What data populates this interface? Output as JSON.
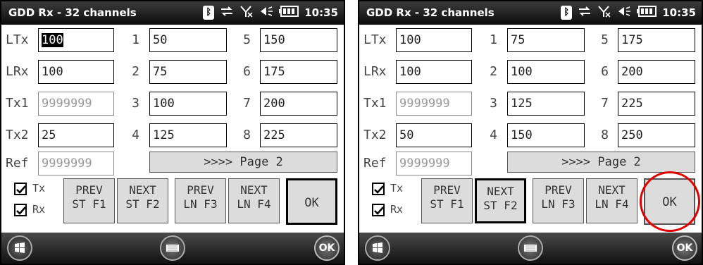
{
  "app_title": "GDD Rx - 32 channels",
  "status": {
    "time": "10:35",
    "icons": [
      "bluetooth-icon",
      "sync-icon",
      "no-signal-icon",
      "volume-icon",
      "battery-icon"
    ]
  },
  "labels": {
    "ltx": "LTx",
    "lrx": "LRx",
    "tx1": "Tx1",
    "tx2": "Tx2",
    "ref": "Ref",
    "ch1": "1",
    "ch2": "2",
    "ch3": "3",
    "ch4": "4",
    "ch5": "5",
    "ch6": "6",
    "ch7": "7",
    "ch8": "8",
    "tx_check": "Tx",
    "rx_check": "Rx"
  },
  "buttons": {
    "page2": ">>>> Page 2",
    "prev_st": [
      "PREV",
      "ST F1"
    ],
    "next_st": [
      "NEXT",
      "ST F2"
    ],
    "prev_ln": [
      "PREV",
      "LN F3"
    ],
    "next_ln": [
      "NEXT",
      "LN F4"
    ],
    "ok": "OK",
    "taskbar_ok": "OK"
  },
  "screens": [
    {
      "ltx": "100",
      "lrx": "100",
      "tx1": "9999999",
      "tx2": "25",
      "ref": "9999999",
      "ch": [
        "50",
        "75",
        "100",
        "125",
        "150",
        "175",
        "200",
        "225"
      ],
      "tx_checked": true,
      "rx_checked": true
    },
    {
      "ltx": "100",
      "lrx": "100",
      "tx1": "9999999",
      "tx2": "50",
      "ref": "9999999",
      "ch": [
        "75",
        "100",
        "125",
        "150",
        "175",
        "200",
        "225",
        "250"
      ],
      "tx_checked": true,
      "rx_checked": true
    }
  ],
  "colors": {
    "highlight": "#e00000",
    "titlebar": "#111111"
  }
}
